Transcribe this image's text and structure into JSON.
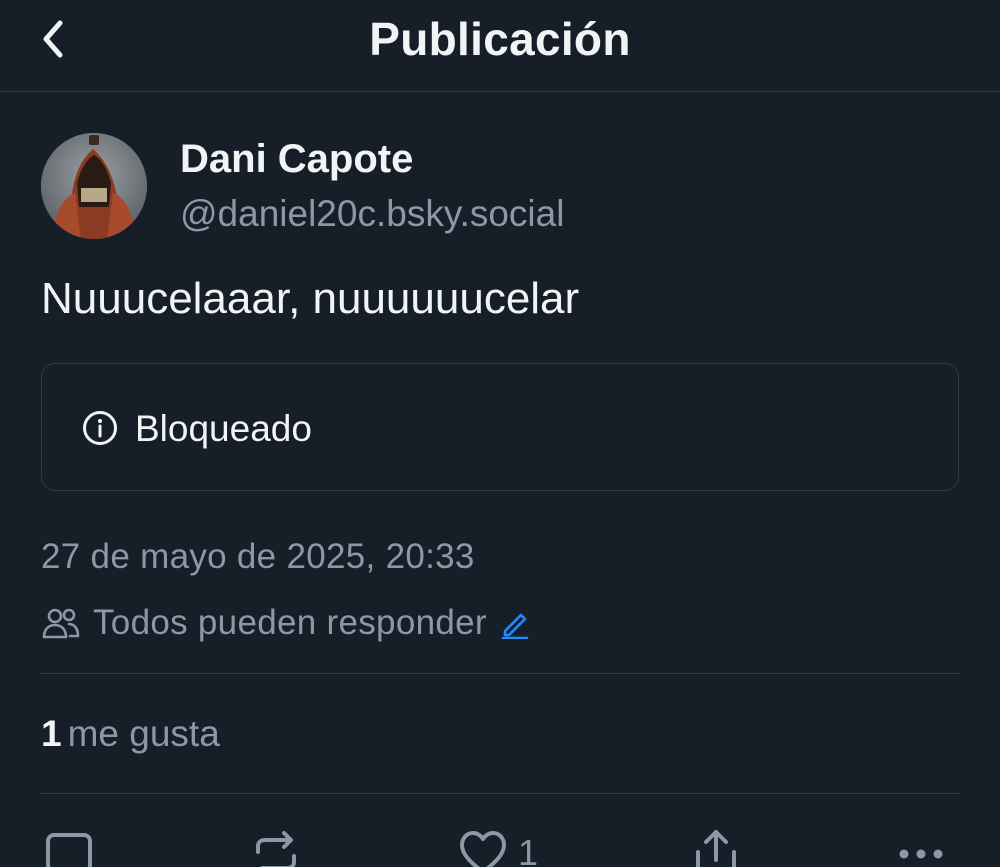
{
  "header": {
    "title": "Publicación",
    "back_icon": "chevron-left-icon"
  },
  "author": {
    "display_name": "Dani Capote",
    "handle": "@daniel20c.bsky.social"
  },
  "post": {
    "text": "Nuuucelaaar, nuuuuuucelar",
    "embed_status": "Bloqueado",
    "timestamp": "27 de mayo de 2025, 20:33",
    "reply_setting": "Todos pueden responder"
  },
  "stats": {
    "likes_count": "1",
    "likes_label": "me gusta"
  },
  "actions": {
    "like_count": "1",
    "icons": [
      "reply-icon",
      "repost-icon",
      "like-icon",
      "share-icon",
      "more-icon"
    ]
  },
  "colors": {
    "background": "#161e27",
    "border": "#2e3a48",
    "text_primary": "#f1f3f5",
    "text_secondary": "#8b98a8",
    "accent": "#208bfe"
  }
}
